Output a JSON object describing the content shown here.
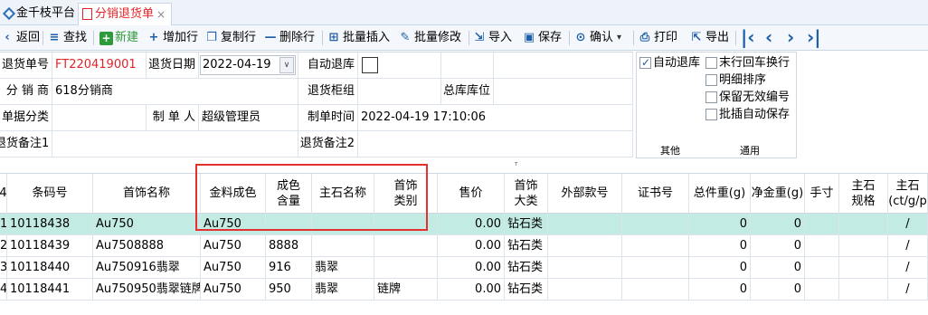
{
  "tabs": {
    "home": "金千枝平台",
    "current": "分销退货单",
    "close": "×"
  },
  "toolbar": {
    "back": "返回",
    "find": "查找",
    "new": "新建",
    "add_row": "增加行",
    "copy_row": "复制行",
    "delete_row": "删除行",
    "batch_insert": "批量插入",
    "batch_edit": "批量修改",
    "import": "导入",
    "save": "保存",
    "confirm": "确认",
    "print": "打印",
    "export": "导出",
    "icons": {
      "back": "‹",
      "find": "≡",
      "new": "+",
      "add": "+",
      "copy": "❐",
      "delete": "—",
      "insert": "⊞",
      "edit": "✎",
      "import": "⇲",
      "save": "▣",
      "confirm": "⊙",
      "print": "⎙",
      "export": "⇱",
      "first": "|‹",
      "prev": "‹",
      "next": "›",
      "last": "›|",
      "dropdown": "▾"
    }
  },
  "form": {
    "return_no_label": "退货单号",
    "return_no": "FT220419001",
    "return_date_label": "退货日期",
    "return_date": "2022-04-19",
    "date_btn": "∨",
    "auto_return_label": "自动退库",
    "distributor_label": "分 销 商",
    "distributor": "618分销商",
    "return_cabinet_label": "退货柜组",
    "return_cabinet": "",
    "main_location_label": "总库库位",
    "main_location": "",
    "doc_category_label": "单据分类",
    "doc_category": "",
    "creator_label": "制 单 人",
    "creator": "超级管理员",
    "create_time_label": "制单时间",
    "create_time": "2022-04-19 17:10:06",
    "remark1_label": "退货备注1",
    "remark1": "",
    "remark2_label": "退货备注2",
    "remark2": ""
  },
  "options": {
    "auto_return": "自动退库",
    "auto_return_checked": true,
    "last_row_enter": "末行回车换行",
    "detail_sort": "明细排序",
    "keep_invalid": "保留无效编号",
    "batch_autosave": "批插自动保存",
    "group_other": "其他",
    "group_general": "通用"
  },
  "splitter": "ᵀ",
  "grid": {
    "columns": [
      "4",
      "条码号",
      "首饰名称",
      "金料成色",
      "成色\n含量",
      "主石名称",
      "首饰\n类别",
      "售价",
      "首饰\n大类",
      "外部款号",
      "证书号",
      "总件重(g)",
      "净金重(g)",
      "手寸",
      "主石\n规格",
      "主石\n(ct/g/p"
    ],
    "rows": [
      {
        "idx": "1",
        "barcode": "10118438",
        "name": "Au750",
        "gold": "Au750",
        "content": "",
        "stone": "",
        "category": "",
        "price": "0.00",
        "major": "钻石类",
        "ext": "",
        "cert": "",
        "total_w": "0",
        "net_w": "0",
        "size": "",
        "spec": "",
        "unit": "/"
      },
      {
        "idx": "2",
        "barcode": "10118439",
        "name": "Au7508888",
        "gold": "Au750",
        "content": "8888",
        "stone": "",
        "category": "",
        "price": "0.00",
        "major": "钻石类",
        "ext": "",
        "cert": "",
        "total_w": "0",
        "net_w": "0",
        "size": "",
        "spec": "",
        "unit": "/"
      },
      {
        "idx": "3",
        "barcode": "10118440",
        "name": "Au750916翡翠",
        "gold": "Au750",
        "content": "916",
        "stone": "翡翠",
        "category": "",
        "price": "0.00",
        "major": "钻石类",
        "ext": "",
        "cert": "",
        "total_w": "0",
        "net_w": "0",
        "size": "",
        "spec": "",
        "unit": "/"
      },
      {
        "idx": "4",
        "barcode": "10118441",
        "name": "Au750950翡翠链牌",
        "gold": "Au750",
        "content": "950",
        "stone": "翡翠",
        "category": "链牌",
        "price": "0.00",
        "major": "钻石类",
        "ext": "",
        "cert": "",
        "total_w": "0",
        "net_w": "0",
        "size": "",
        "spec": "",
        "unit": "/"
      }
    ]
  },
  "colors": {
    "accent": "#1f5fa8",
    "selected_row": "#c2ebe4",
    "highlight": "#e53030",
    "red_text": "#e0242a"
  }
}
